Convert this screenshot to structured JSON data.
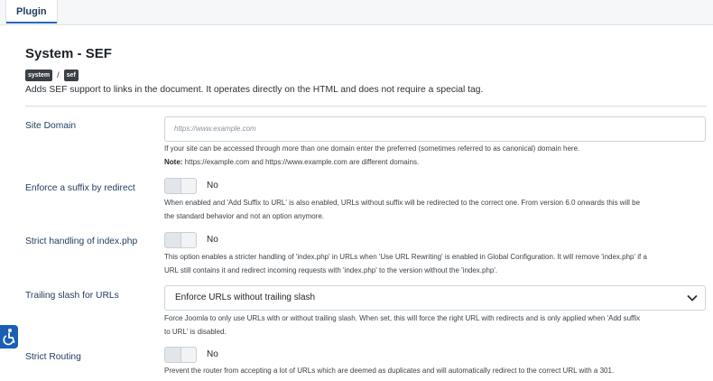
{
  "tabs": [
    {
      "label": "Plugin",
      "active": true
    }
  ],
  "plugin": {
    "title": "System - SEF",
    "badges": [
      "system",
      "sef"
    ],
    "separator": "/",
    "description": "Adds SEF support to links in the document. It operates directly on the HTML and does not require a special tag."
  },
  "fields": {
    "site_domain": {
      "label": "Site Domain",
      "placeholder": "https://www.example.com",
      "help1": "If your site can be accessed through more than one domain enter the preferred (sometimes referred to as canonical) domain here.",
      "note_label": "Note:",
      "note_text": " https://example.com and https://www.example.com are different domains."
    },
    "enforce_suffix": {
      "label": "Enforce a suffix by redirect",
      "state": "No",
      "help1": "When enabled and 'Add Suffix to URL' is also enabled, URLs without suffix will be redirected to the correct one. From version 6.0 onwards this will be",
      "help2": "the standard behavior and not an option anymore."
    },
    "strict_index": {
      "label": "Strict handling of index.php",
      "state": "No",
      "help1": "This option enables a stricter handling of 'index.php' in URLs when 'Use URL Rewriting' is enabled in Global Configuration. It will remove 'index.php' if a",
      "help2": "URL still contains it and redirect incoming requests with 'index.php' to the version without the 'index.php'."
    },
    "trailing_slash": {
      "label": "Trailing slash for URLs",
      "value": "Enforce URLs without trailing slash",
      "help1": "Force Joomla to only use URLs with or without trailing slash. When set, this will force the right URL with redirects and is only applied when 'Add suffix",
      "help2": "to URL' is disabled."
    },
    "strict_routing": {
      "label": "Strict Routing",
      "state": "No",
      "help1": "Prevent the router from accepting a lot of URLs which are deemed as duplicates and will automatically redirect to the correct URL with a 301."
    }
  },
  "icons": {
    "accessibility": "accessibility-icon",
    "select": "chevron-down-icon"
  },
  "colors": {
    "accent": "#2a69b8",
    "label": "#1f3a5c",
    "badge": "#3b4047",
    "access": "#1a5fb4"
  }
}
